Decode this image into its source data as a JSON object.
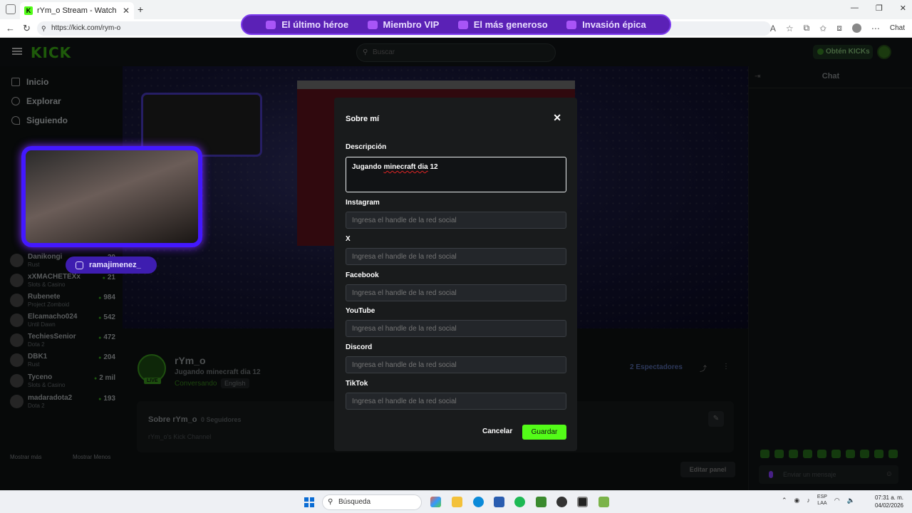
{
  "browser": {
    "tab_title": "rYm_o Stream - Watch Live on Kick",
    "url": "https://kick.com/rym-o",
    "chat_label": "Chat"
  },
  "banner": {
    "items": [
      {
        "label": "El último héroe",
        "icon": "heart-icon"
      },
      {
        "label": "Miembro VIP",
        "icon": "star-icon"
      },
      {
        "label": "El más generoso",
        "icon": "gift-icon"
      },
      {
        "label": "Invasión épica",
        "icon": "alien-icon"
      }
    ]
  },
  "kick": {
    "logo": "KICK",
    "search_placeholder": "Buscar",
    "get_kicks": "Obtén KICKs"
  },
  "sidebar": {
    "nav": [
      {
        "label": "Inicio",
        "icon": "home-icon"
      },
      {
        "label": "Explorar",
        "icon": "compass-icon"
      },
      {
        "label": "Siguiendo",
        "icon": "heart-icon"
      }
    ],
    "channels": [
      {
        "name": "Danikongi",
        "game": "Rust",
        "count": "20"
      },
      {
        "name": "xXMACHETEXx",
        "game": "Slots & Casino",
        "count": "21"
      },
      {
        "name": "Rubenete",
        "game": "Project Zomboid",
        "count": "984"
      },
      {
        "name": "Elcamacho024",
        "game": "Until Dawn",
        "count": "542"
      },
      {
        "name": "TechiesSenior",
        "game": "Dota 2",
        "count": "472"
      },
      {
        "name": "DBK1",
        "game": "Rust",
        "count": "204"
      },
      {
        "name": "Tyceno",
        "game": "Slots & Casino",
        "count": "2 mil"
      },
      {
        "name": "madaradota2",
        "game": "Dota 2",
        "count": "193"
      }
    ],
    "show_more": "Mostrar más",
    "show_less": "Mostrar Menos"
  },
  "overlay": {
    "instagram_handle": "ramajimenez_"
  },
  "stream": {
    "channel": "rYm_o",
    "title": "Jugando minecraft dia 12",
    "category": "Conversando",
    "language": "English",
    "live": "LIVE",
    "viewers": "2 Espectadores"
  },
  "about": {
    "title": "Sobre rYm_o",
    "followers": "0 Seguidores",
    "description": "rYm_o's Kick Channel",
    "edit_panel": "Editar panel"
  },
  "chat": {
    "title": "Chat",
    "input_placeholder": "Enviar un mensaje"
  },
  "modal": {
    "title": "Sobre mí",
    "description_label": "Descripción",
    "description_value_a": "Jugando ",
    "description_value_b": "minecraft dia",
    "description_value_c": " 12",
    "fields": [
      {
        "label": "Instagram",
        "placeholder": "Ingresa el handle de la red social"
      },
      {
        "label": "X",
        "placeholder": "Ingresa el handle de la red social"
      },
      {
        "label": "Facebook",
        "placeholder": "Ingresa el handle de la red social"
      },
      {
        "label": "YouTube",
        "placeholder": "Ingresa el handle de la red social"
      },
      {
        "label": "Discord",
        "placeholder": "Ingresa el handle de la red social"
      },
      {
        "label": "TikTok",
        "placeholder": "Ingresa el handle de la red social"
      }
    ],
    "cancel": "Cancelar",
    "save": "Guardar"
  },
  "taskbar": {
    "search": "Búsqueda",
    "lang_line1": "ESP",
    "lang_line2": "LAA",
    "time": "07:31 a. m.",
    "date": "04/02/2026"
  }
}
